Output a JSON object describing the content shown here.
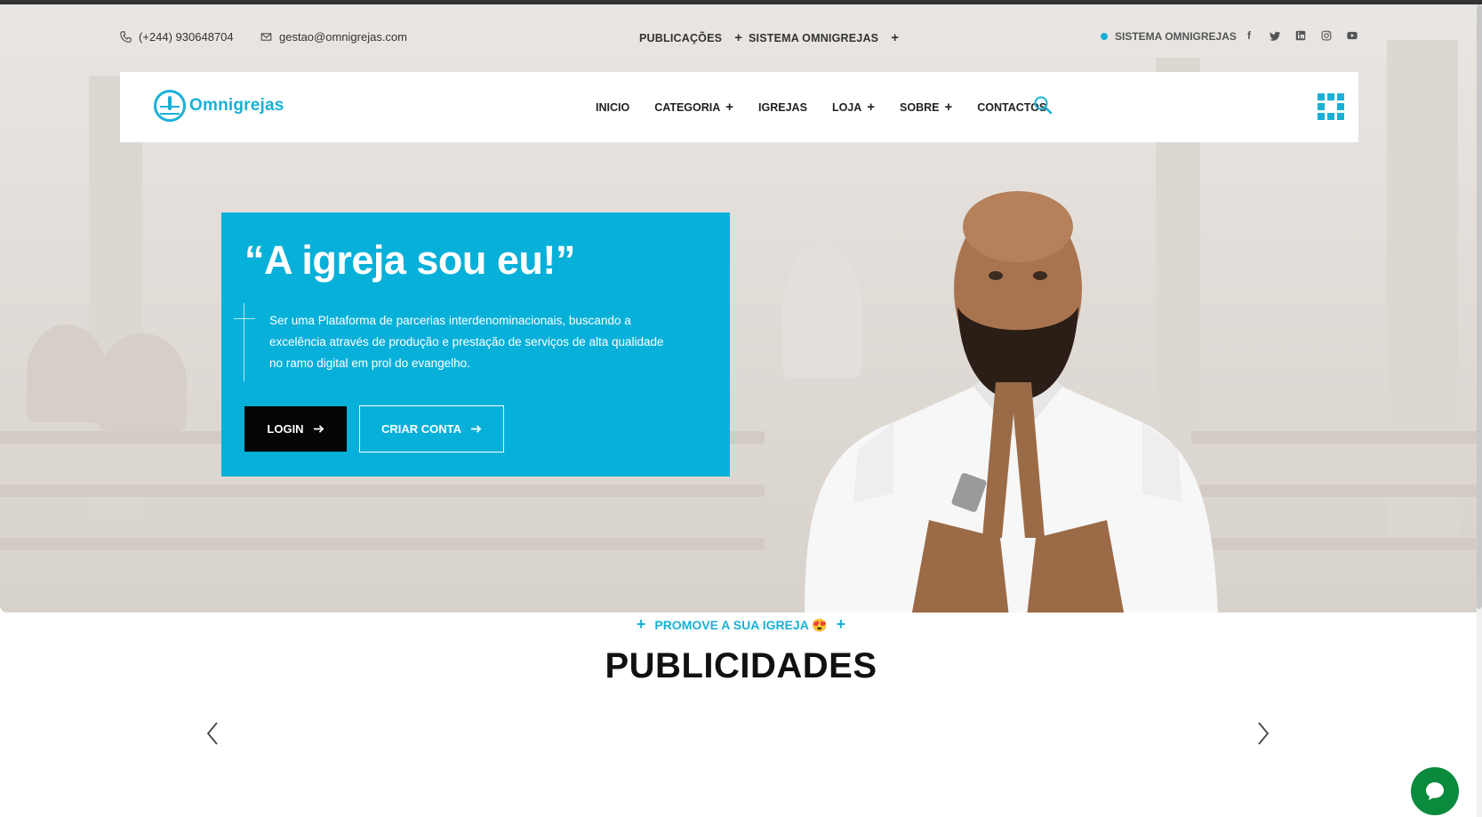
{
  "topbar": {
    "phone": "(+244) 930648704",
    "email": "gestao@omnigrejas.com",
    "nav": [
      {
        "label": "PUBLICAÇÕES",
        "plus": "+"
      },
      {
        "label": "SISTEMA OMNIGREJAS",
        "plus": "+"
      }
    ],
    "status_label": "SISTEMA OMNIGREJAS",
    "social_icons": [
      "facebook-icon",
      "twitter-icon",
      "linkedin-icon",
      "instagram-icon",
      "youtube-icon"
    ]
  },
  "navbar": {
    "logo_text": "Omnigrejas",
    "items": [
      {
        "label": "INICIO",
        "plus": ""
      },
      {
        "label": "CATEGORIA",
        "plus": "+"
      },
      {
        "label": "IGREJAS",
        "plus": ""
      },
      {
        "label": "LOJA",
        "plus": "+"
      },
      {
        "label": "SOBRE",
        "plus": "+"
      },
      {
        "label": "CONTACTOS",
        "plus": ""
      }
    ]
  },
  "hero": {
    "title": "“A igreja sou eu!”",
    "description": "Ser uma Plataforma de parcerias interdenominacionais, buscando a excelência através de produção e prestação de serviços de alta qualidade no ramo digital em prol do evangelho.",
    "login_label": "LOGIN",
    "register_label": "CRIAR CONTA"
  },
  "section": {
    "promo_text": "PROMOVE A SUA IGREJA 😍",
    "plus": "+",
    "title": "PUBLICIDADES"
  },
  "colors": {
    "accent": "#07b0d9",
    "chat": "#0a8a3c"
  }
}
